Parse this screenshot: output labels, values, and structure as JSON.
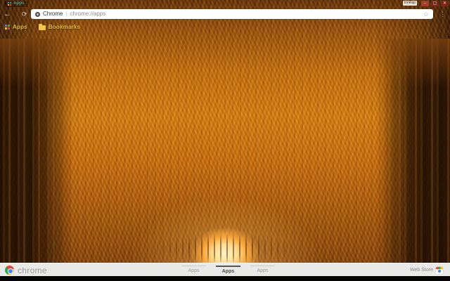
{
  "window": {
    "controls": {
      "minimize": "–",
      "maximize": "▢",
      "close": "✕",
      "badge": "InnRap"
    }
  },
  "tab": {
    "title": "Apps",
    "favicon": "apps-grid-icon"
  },
  "toolbar": {
    "back": "←",
    "refresh": "⟳",
    "menu": "⋮",
    "omnibox": {
      "site_label": "Chrome",
      "separator": "|",
      "url": "chrome://apps",
      "bookmark_star": "☆"
    }
  },
  "bookmarks_bar": {
    "items": [
      {
        "label": "Apps",
        "icon": "apps-grid-icon"
      },
      {
        "label": "Bookmarks",
        "icon": "folder-icon"
      }
    ]
  },
  "footer": {
    "brand": "chrome",
    "nav": [
      {
        "label": "Apps",
        "selected": false
      },
      {
        "label": "Apps",
        "selected": true
      },
      {
        "label": "Apps",
        "selected": false
      }
    ],
    "web_store": "Web Store"
  },
  "colors": {
    "bookmark_text": "#e5bb3e",
    "tab_text": "#6fc7b2",
    "footer_bg": "#e9e9e7",
    "footer_text": "#9a9a9a",
    "footer_selected_text": "#4a4a4a",
    "omnibox_bg": "#ffffff",
    "window_button_bg": "#87261a",
    "wallpaper_canopy": "#d68114",
    "wallpaper_trunks": "#2a1405",
    "wallpaper_glow": "#fff4c8"
  },
  "icon_palette": {
    "blue": "#4285f4",
    "green": "#34a853",
    "yellow": "#fbbc05",
    "red": "#ea4335"
  }
}
